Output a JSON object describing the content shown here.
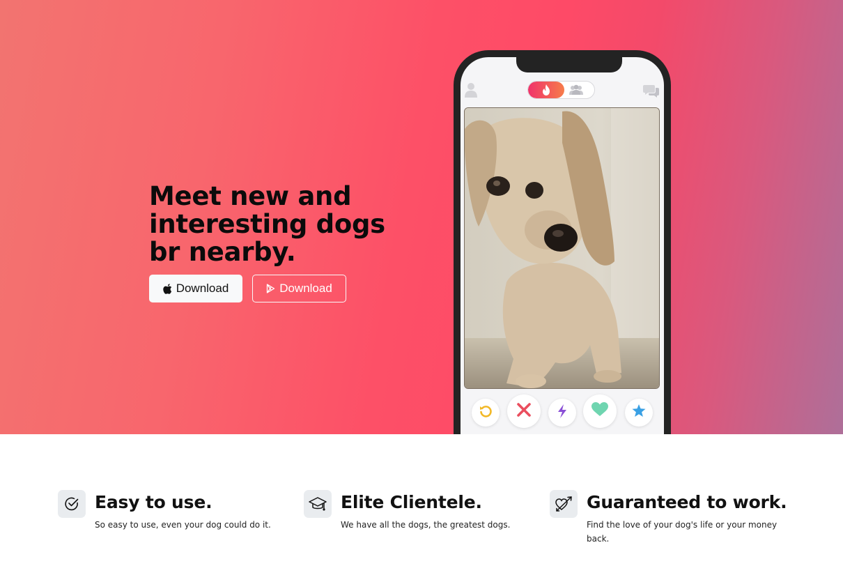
{
  "hero": {
    "title": "Meet new and interesting dogs br nearby.",
    "apple_button": {
      "label": "Download",
      "icon": "apple-icon"
    },
    "play_button": {
      "label": "Download",
      "icon": "google-play-icon"
    }
  },
  "phone": {
    "top_bar": [
      "profile-icon",
      "flame-icon",
      "group-icon",
      "chat-icon"
    ],
    "actions": [
      "rewind-icon",
      "nope-icon",
      "boost-icon",
      "like-icon",
      "super-like-icon"
    ]
  },
  "features": [
    {
      "icon": "check-circle-icon",
      "title": "Easy to use.",
      "text": "So easy to use, even your dog could do it."
    },
    {
      "icon": "graduation-cap-icon",
      "title": "Elite Clientele.",
      "text": "We have all the dogs, the greatest dogs."
    },
    {
      "icon": "heart-arrow-icon",
      "title": "Guaranteed to work.",
      "text": "Find the love of your dog's life or your money back."
    }
  ],
  "colors": {
    "gradient_start": "#f27470",
    "gradient_mid": "#fe4a67",
    "gradient_end": "#ae6f99",
    "phone_frame": "#232323",
    "feature_icon_bg": "#e9ecef"
  }
}
